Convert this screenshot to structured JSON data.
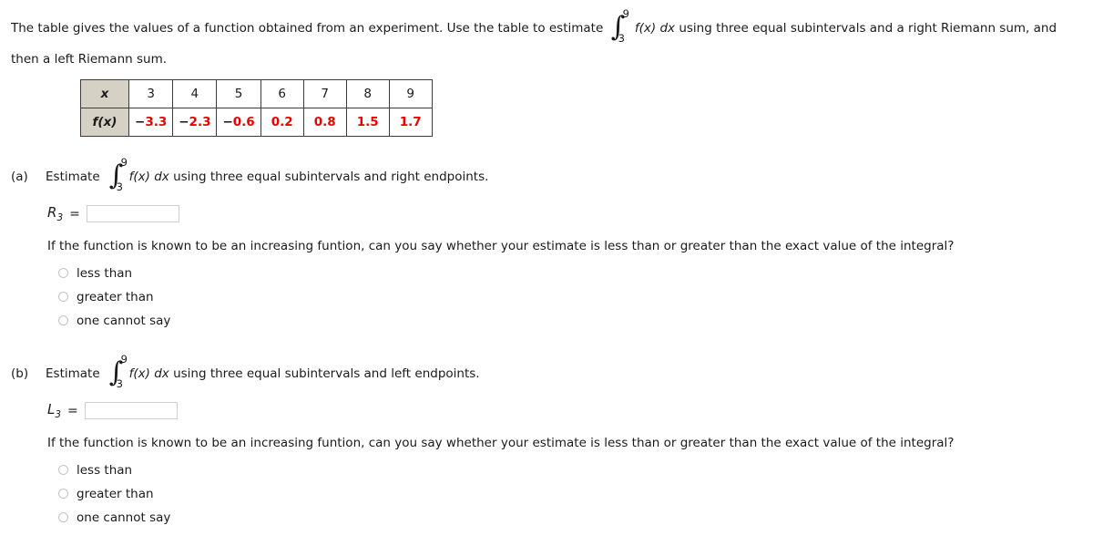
{
  "prompt": {
    "before_integral": "The table gives the values of a function obtained from an experiment. Use the table to estimate",
    "integral": {
      "upper": "9",
      "lower": "3",
      "sign": "∫",
      "integrand": "f(x) dx"
    },
    "after_integral": "using three equal subintervals and a right Riemann sum, and then a left Riemann sum."
  },
  "table": {
    "row_headers": [
      "x",
      "f(x)"
    ],
    "x_values": [
      "3",
      "4",
      "5",
      "6",
      "7",
      "8",
      "9"
    ],
    "f_values": [
      "−3.3",
      "−2.3",
      "−0.6",
      "0.2",
      "0.8",
      "1.5",
      "1.7"
    ],
    "header_bg": "#d5d1c4",
    "value_color": "#ee0000",
    "border_color": "#3d3d3d"
  },
  "parts": [
    {
      "label": "(a)",
      "estimate_word": "Estimate",
      "integral": {
        "upper": "9",
        "lower": "3",
        "sign": "∫",
        "integrand": "f(x) dx"
      },
      "tail": "using three equal subintervals and right endpoints.",
      "answer": {
        "symbol": "R",
        "subscript": "3",
        "equals": "=",
        "value": "",
        "placeholder": ""
      },
      "followup": "If the function is known to be an increasing funtion, can you say whether your estimate is less than or greater than the exact value of the integral?",
      "options": [
        "less than",
        "greater than",
        "one cannot say"
      ]
    },
    {
      "label": "(b)",
      "estimate_word": "Estimate",
      "integral": {
        "upper": "9",
        "lower": "3",
        "sign": "∫",
        "integrand": "f(x) dx"
      },
      "tail": "using three equal subintervals and left endpoints.",
      "answer": {
        "symbol": "L",
        "subscript": "3",
        "equals": "=",
        "value": "",
        "placeholder": ""
      },
      "followup": "If the function is known to be an increasing funtion, can you say whether your estimate is less than or greater than the exact value of the integral?",
      "options": [
        "less than",
        "greater than",
        "one cannot say"
      ]
    }
  ]
}
